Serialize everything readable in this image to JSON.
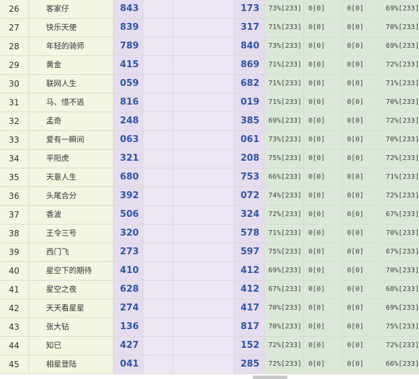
{
  "rows": [
    {
      "idx": "26",
      "name": "客家仔",
      "n1": "843",
      "n2": "173",
      "p1": "73%[233]",
      "p2": "0[0]",
      "p3": "0[0]",
      "p4": "69%[233]"
    },
    {
      "idx": "27",
      "name": "快乐天使",
      "n1": "839",
      "n2": "317",
      "p1": "71%[233]",
      "p2": "0[0]",
      "p3": "0[0]",
      "p4": "70%[233]"
    },
    {
      "idx": "28",
      "name": "年轻的骑师",
      "n1": "789",
      "n2": "840",
      "p1": "73%[233]",
      "p2": "0[0]",
      "p3": "0[0]",
      "p4": "69%[233]"
    },
    {
      "idx": "29",
      "name": "黄金",
      "n1": "415",
      "n2": "869",
      "p1": "71%[233]",
      "p2": "0[0]",
      "p3": "0[0]",
      "p4": "72%[233]"
    },
    {
      "idx": "30",
      "name": "联网人生",
      "n1": "059",
      "n2": "682",
      "p1": "71%[233]",
      "p2": "0[0]",
      "p3": "0[0]",
      "p4": "71%[233]"
    },
    {
      "idx": "31",
      "name": "马、惜不逃",
      "n1": "816",
      "n2": "019",
      "p1": "71%[233]",
      "p2": "0[0]",
      "p3": "0[0]",
      "p4": "70%[233]"
    },
    {
      "idx": "32",
      "name": "孟奇",
      "n1": "248",
      "n2": "385",
      "p1": "69%[233]",
      "p2": "0[0]",
      "p3": "0[0]",
      "p4": "72%[233]"
    },
    {
      "idx": "33",
      "name": "爱有一瞬间",
      "n1": "063",
      "n2": "061",
      "p1": "73%[233]",
      "p2": "0[0]",
      "p3": "0[0]",
      "p4": "70%[233]"
    },
    {
      "idx": "34",
      "name": "平阳虎",
      "n1": "321",
      "n2": "208",
      "p1": "75%[233]",
      "p2": "0[0]",
      "p3": "0[0]",
      "p4": "72%[233]"
    },
    {
      "idx": "35",
      "name": "天意人生",
      "n1": "680",
      "n2": "753",
      "p1": "66%[233]",
      "p2": "0[0]",
      "p3": "0[0]",
      "p4": "71%[233]"
    },
    {
      "idx": "36",
      "name": "头尾合分",
      "n1": "392",
      "n2": "072",
      "p1": "74%[233]",
      "p2": "0[0]",
      "p3": "0[0]",
      "p4": "72%[233]"
    },
    {
      "idx": "37",
      "name": "香波",
      "n1": "506",
      "n2": "324",
      "p1": "72%[233]",
      "p2": "0[0]",
      "p3": "0[0]",
      "p4": "67%[233]"
    },
    {
      "idx": "38",
      "name": "王令三号",
      "n1": "320",
      "n2": "578",
      "p1": "71%[233]",
      "p2": "0[0]",
      "p3": "0[0]",
      "p4": "70%[233]"
    },
    {
      "idx": "39",
      "name": "西门飞",
      "n1": "273",
      "n2": "597",
      "p1": "75%[233]",
      "p2": "0[0]",
      "p3": "0[0]",
      "p4": "67%[233]"
    },
    {
      "idx": "40",
      "name": "星空下的期待",
      "n1": "410",
      "n2": "412",
      "p1": "69%[233]",
      "p2": "0[0]",
      "p3": "0[0]",
      "p4": "70%[233]"
    },
    {
      "idx": "41",
      "name": "星空之夜",
      "n1": "628",
      "n2": "412",
      "p1": "67%[233]",
      "p2": "0[0]",
      "p3": "0[0]",
      "p4": "68%[233]"
    },
    {
      "idx": "42",
      "name": "天天看星星",
      "n1": "274",
      "n2": "417",
      "p1": "70%[233]",
      "p2": "0[0]",
      "p3": "0[0]",
      "p4": "69%[233]"
    },
    {
      "idx": "43",
      "name": "张大钻",
      "n1": "136",
      "n2": "817",
      "p1": "70%[233]",
      "p2": "0[0]",
      "p3": "0[0]",
      "p4": "75%[233]"
    },
    {
      "idx": "44",
      "name": "知已",
      "n1": "427",
      "n2": "152",
      "p1": "72%[233]",
      "p2": "0[0]",
      "p3": "0[0]",
      "p4": "72%[233]"
    },
    {
      "idx": "45",
      "name": "相星登陆",
      "n1": "041",
      "n2": "285",
      "p1": "72%[233]",
      "p2": "0[0]",
      "p3": "0[0]",
      "p4": "66%[233]"
    }
  ]
}
